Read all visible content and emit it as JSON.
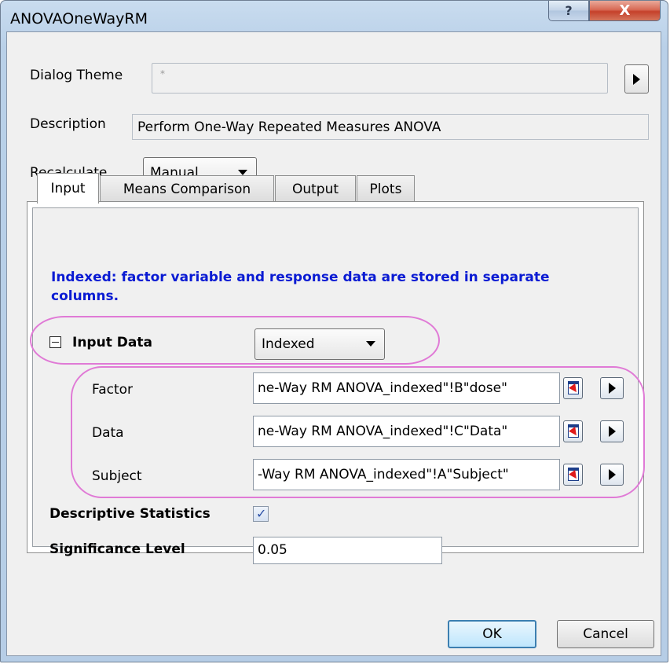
{
  "window": {
    "title": "ANOVAOneWayRM",
    "help_label": "?",
    "close_label": "X"
  },
  "dialog_theme": {
    "label": "Dialog Theme",
    "value": "*"
  },
  "description": {
    "label": "Description",
    "value": "Perform One-Way Repeated Measures ANOVA"
  },
  "recalculate": {
    "label": "Recalculate",
    "value": "Manual"
  },
  "tabs": [
    {
      "label": "Input",
      "active": true
    },
    {
      "label": "Means Comparison",
      "active": false
    },
    {
      "label": "Output",
      "active": false
    },
    {
      "label": "Plots",
      "active": false
    }
  ],
  "info_text": "Indexed: factor variable and response data are stored in separate columns.",
  "input_data": {
    "label": "Input Data",
    "mode": "Indexed",
    "fields": [
      {
        "label": "Factor",
        "value": "ne-Way RM ANOVA_indexed\"!B\"dose\""
      },
      {
        "label": "Data",
        "value": "ne-Way RM ANOVA_indexed\"!C\"Data\""
      },
      {
        "label": "Subject",
        "value": "-Way RM ANOVA_indexed\"!A\"Subject\""
      }
    ]
  },
  "descriptive_statistics": {
    "label": "Descriptive Statistics",
    "checked": true,
    "mark": "✓"
  },
  "significance_level": {
    "label": "Significance Level",
    "value": "0.05"
  },
  "buttons": {
    "ok": "OK",
    "cancel": "Cancel"
  },
  "colors": {
    "info_text": "#0a1bd3",
    "highlight": "#e07ad6",
    "close_button": "#c5412b"
  }
}
